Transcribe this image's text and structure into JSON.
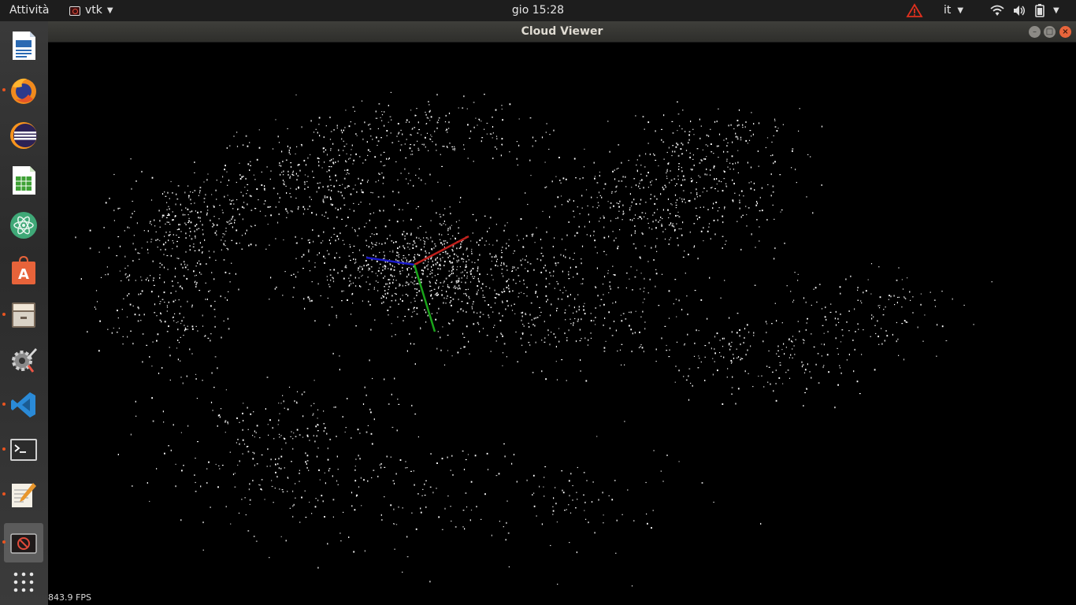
{
  "topbar": {
    "activities": "Attività",
    "app_name": "vtk",
    "clock": "gio 15:28",
    "language": "it"
  },
  "window": {
    "title": "Cloud Viewer"
  },
  "dock": {
    "items": [
      {
        "name": "writer",
        "icon": "libreoffice-writer-icon",
        "running": false
      },
      {
        "name": "firefox",
        "icon": "firefox-icon",
        "running": true
      },
      {
        "name": "eclipse",
        "icon": "eclipse-icon",
        "running": false
      },
      {
        "name": "calc",
        "icon": "libreoffice-calc-icon",
        "running": false
      },
      {
        "name": "atom",
        "icon": "atom-icon",
        "running": false
      },
      {
        "name": "software",
        "icon": "ubuntu-software-icon",
        "running": false
      },
      {
        "name": "files",
        "icon": "files-icon",
        "running": true
      },
      {
        "name": "settings",
        "icon": "settings-icon",
        "running": false
      },
      {
        "name": "vscode",
        "icon": "vscode-icon",
        "running": true
      },
      {
        "name": "terminal",
        "icon": "terminal-icon",
        "running": true
      },
      {
        "name": "text-editor",
        "icon": "text-editor-icon",
        "running": true
      },
      {
        "name": "vtk-viewer",
        "icon": "vtk-icon",
        "running": true,
        "active": true
      }
    ],
    "show_apps_icon": "app-grid-icon"
  },
  "viewer": {
    "fps": "843.9 FPS",
    "axis_colors": {
      "x": "#c0201c",
      "y": "#1aa51a",
      "z": "#1a1acc"
    }
  }
}
